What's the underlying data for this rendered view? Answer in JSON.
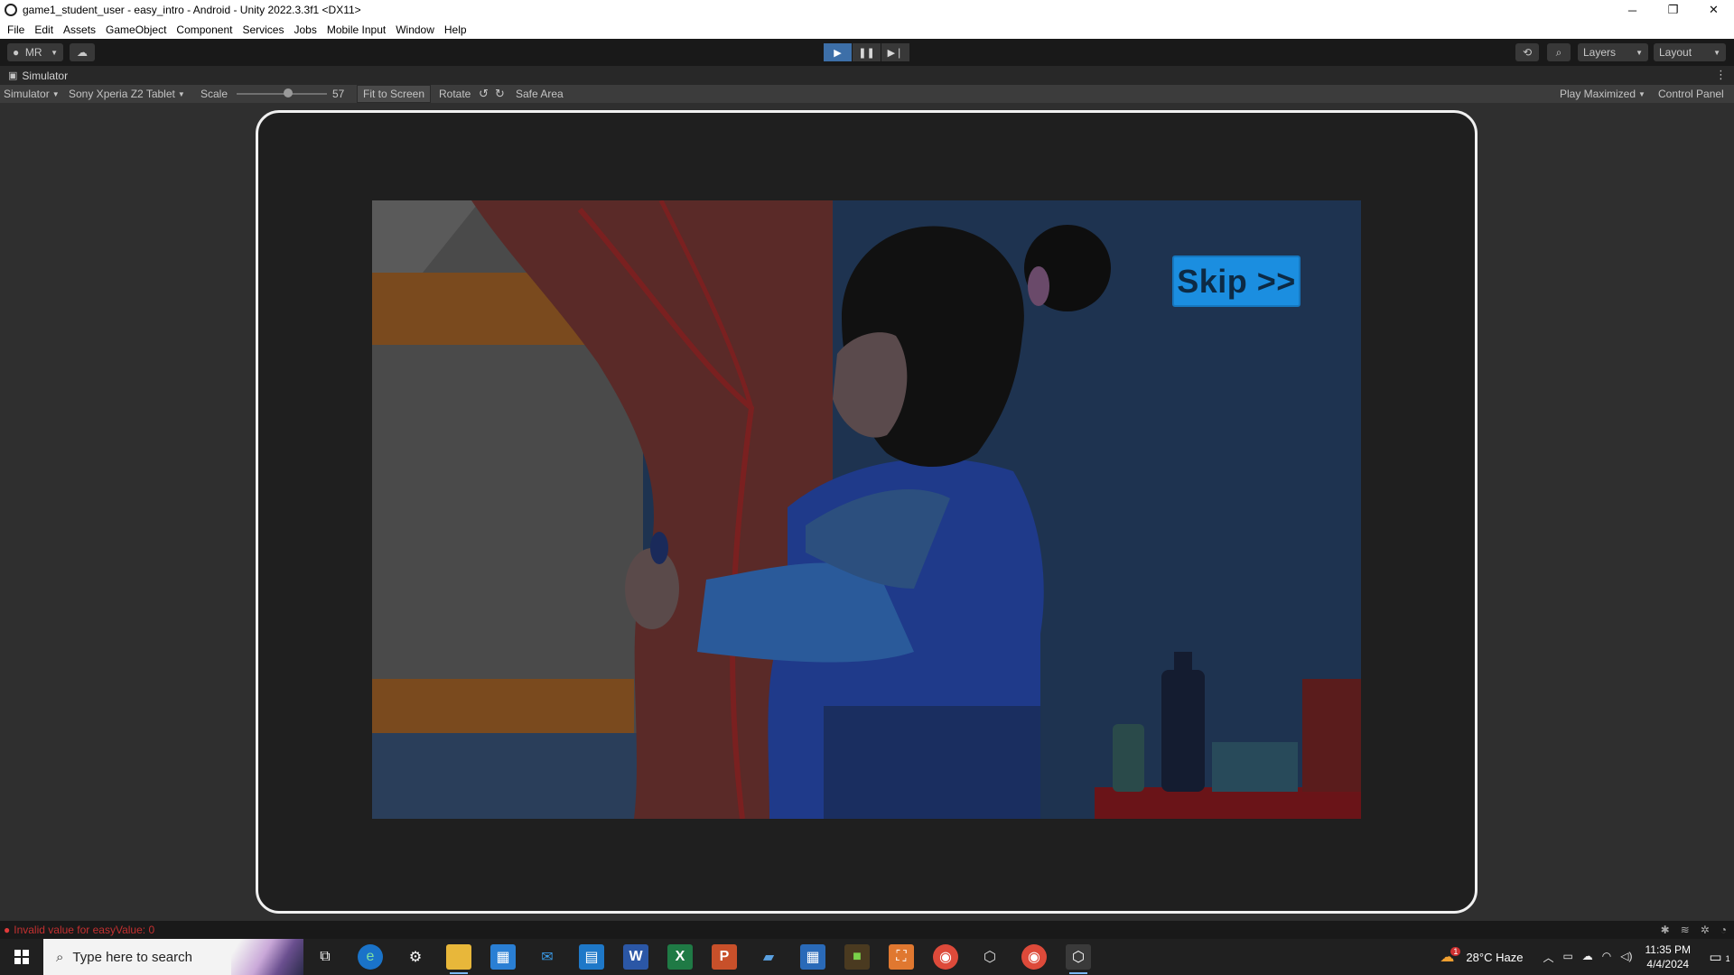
{
  "window": {
    "title": "game1_student_user - easy_intro - Android - Unity 2022.3.3f1 <DX11>",
    "controls": [
      "─",
      "❐",
      "✕"
    ]
  },
  "menu": [
    "File",
    "Edit",
    "Assets",
    "GameObject",
    "Component",
    "Services",
    "Jobs",
    "Mobile Input",
    "Window",
    "Help"
  ],
  "toolbar": {
    "account": "MR",
    "layers": "Layers",
    "layout": "Layout",
    "play_mode": "playing"
  },
  "tab": {
    "label": "Simulator"
  },
  "simbar": {
    "view_mode": "Simulator",
    "device": "Sony Xperia Z2 Tablet",
    "scale_label": "Scale",
    "scale_value": "57",
    "fit": "Fit to Screen",
    "rotate": "Rotate",
    "safe_area": "Safe Area",
    "play_mode": "Play Maximized",
    "control_panel": "Control Panel"
  },
  "game": {
    "skip_label": "Skip >>"
  },
  "status": {
    "error": "Invalid value for easyValue: 0"
  },
  "taskbar": {
    "search_placeholder": "Type here to search",
    "weather": "28°C  Haze",
    "weather_badge": "1",
    "time": "11:35 PM",
    "date": "4/4/2024",
    "notif_count": "1"
  },
  "colors": {
    "accent_play": "#3d6fa8",
    "skip_button": "#1b8ee0",
    "error_text": "#c43030"
  }
}
